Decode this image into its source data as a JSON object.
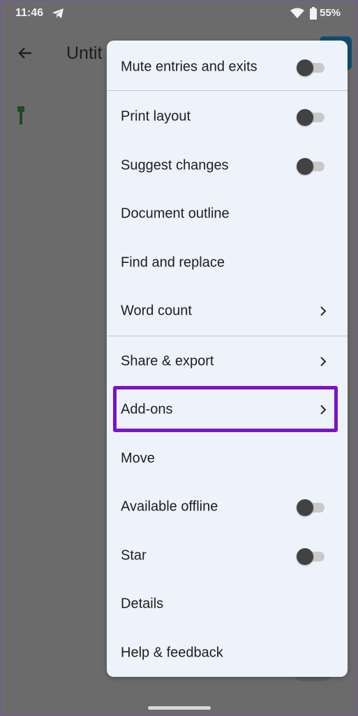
{
  "status_bar": {
    "time": "11:46",
    "battery": "55%"
  },
  "app_bar": {
    "title": "Untit"
  },
  "menu": {
    "items": [
      {
        "label": "Mute entries and exits",
        "toggle": false
      },
      {
        "label": "Print layout",
        "toggle": false
      },
      {
        "label": "Suggest changes",
        "toggle": false
      },
      {
        "label": "Document outline"
      },
      {
        "label": "Find and replace"
      },
      {
        "label": "Word count",
        "submenu": true
      },
      {
        "label": "Share & export",
        "submenu": true
      },
      {
        "label": "Add-ons",
        "submenu": true,
        "highlighted": true
      },
      {
        "label": "Move"
      },
      {
        "label": "Available offline",
        "toggle": false
      },
      {
        "label": "Star",
        "toggle": false
      },
      {
        "label": "Details"
      },
      {
        "label": "Help & feedback"
      }
    ]
  },
  "colors": {
    "highlight": "#7a14c8",
    "menu_bg": "#eef3fb",
    "scrim": "#6b6b6b"
  }
}
